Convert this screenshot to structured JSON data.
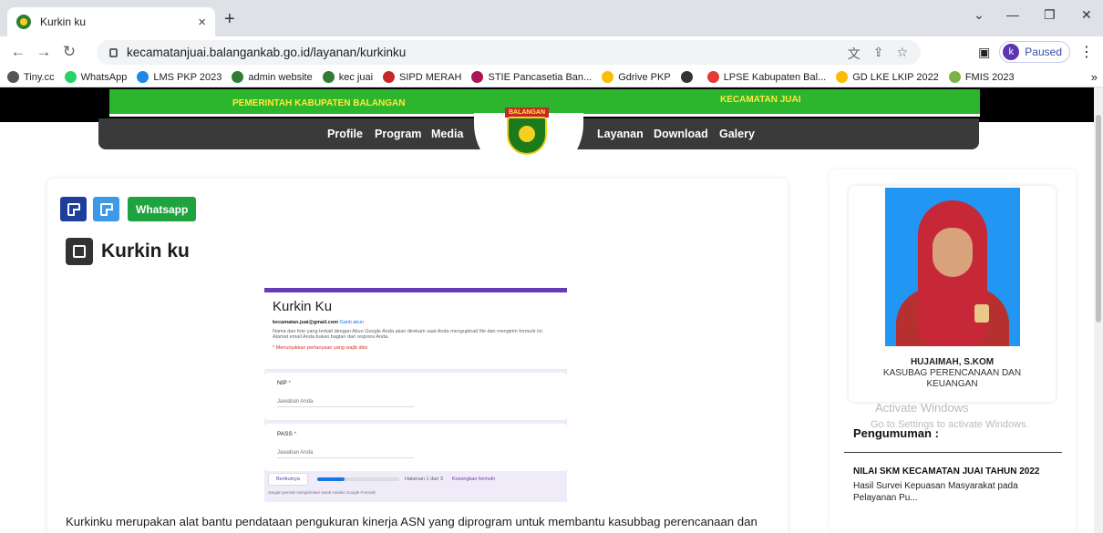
{
  "browser": {
    "tab_title": "Kurkin ku",
    "tab_close": "×",
    "new_tab": "+",
    "url": "kecamatanjuai.balangankab.go.id/layanan/kurkinku",
    "profile_initial": "k",
    "profile_status": "Paused",
    "window_controls": [
      "⌄",
      "—",
      "❐",
      "✕"
    ],
    "bookmarks": [
      {
        "label": "Tiny.cc",
        "color": "#555555"
      },
      {
        "label": "WhatsApp",
        "color": "#25d366"
      },
      {
        "label": "LMS PKP 2023",
        "color": "#1e88e5"
      },
      {
        "label": "admin website",
        "color": "#2e7d32"
      },
      {
        "label": "kec juai",
        "color": "#2e7d32"
      },
      {
        "label": "SIPD MERAH",
        "color": "#c62828"
      },
      {
        "label": "STIE Pancasetia Ban...",
        "color": "#ad1457"
      },
      {
        "label": "Gdrive PKP",
        "color": "#fbbc04"
      },
      {
        "label": "",
        "color": "#333333"
      },
      {
        "label": "LPSE Kabupaten Bal...",
        "color": "#e53935"
      },
      {
        "label": "GD LKE LKIP 2022",
        "color": "#fbbc04"
      },
      {
        "label": "FMIS 2023",
        "color": "#7cb342"
      }
    ],
    "more_bookmarks": "»"
  },
  "site": {
    "header_left": "PEMERINTAH KABUPATEN BALANGAN",
    "header_right": "KECAMATAN JUAI",
    "logo_text": "BALANGAN",
    "nav_left": [
      "Profile",
      "Program",
      "Media"
    ],
    "nav_right": [
      "Layanan",
      "Download",
      "Galery"
    ]
  },
  "article": {
    "whatsapp_label": "Whatsapp",
    "title": "Kurkin ku",
    "body": "Kurkinku merupakan alat bantu pendataan pengukuran kinerja ASN yang diprogram untuk membantu kasubbag perencanaan dan keuangan kecamatan juai dalam melakukan rekapitulasi , pengisian dokumen laporan pengukuran capaian kinerja per triwulan atas"
  },
  "form_image": {
    "title": "Kurkin Ku",
    "email": "kecamatan.juai@gmail.com",
    "switch_account": "Ganti akun",
    "notice": "Nama dan foto yang terkait dengan Akun Google Anda akan direkam saat Anda mengupload file dan mengirim formulir ini. Alamat email Anda bukan bagian dari respons Anda.",
    "required_note": "* Menunjukkan pertanyaan yang wajib diisi",
    "q1": "NIP",
    "q2": "PASS",
    "answer_placeholder": "Jawaban Anda",
    "next": "Berikutnya",
    "page_info": "Halaman 1 dari 3",
    "clear": "Kosongkan formulir",
    "footer": "Jangan pernah mengirimkan sandi melalui Google Formulir."
  },
  "sidebar": {
    "profile_name": "HUJAIMAH, S.KOM",
    "profile_role": "KASUBAG PERENCANAAN DAN KEUANGAN",
    "announcement_heading": "Pengumuman :",
    "announcement_title": "NILAI SKM KECAMATAN JUAI TAHUN 2022",
    "announcement_body": "Hasil Survei Kepuasan Masyarakat pada Pelayanan Pu..."
  },
  "watermark": {
    "line1": "Activate Windows",
    "line2": "Go to Settings to activate Windows."
  }
}
